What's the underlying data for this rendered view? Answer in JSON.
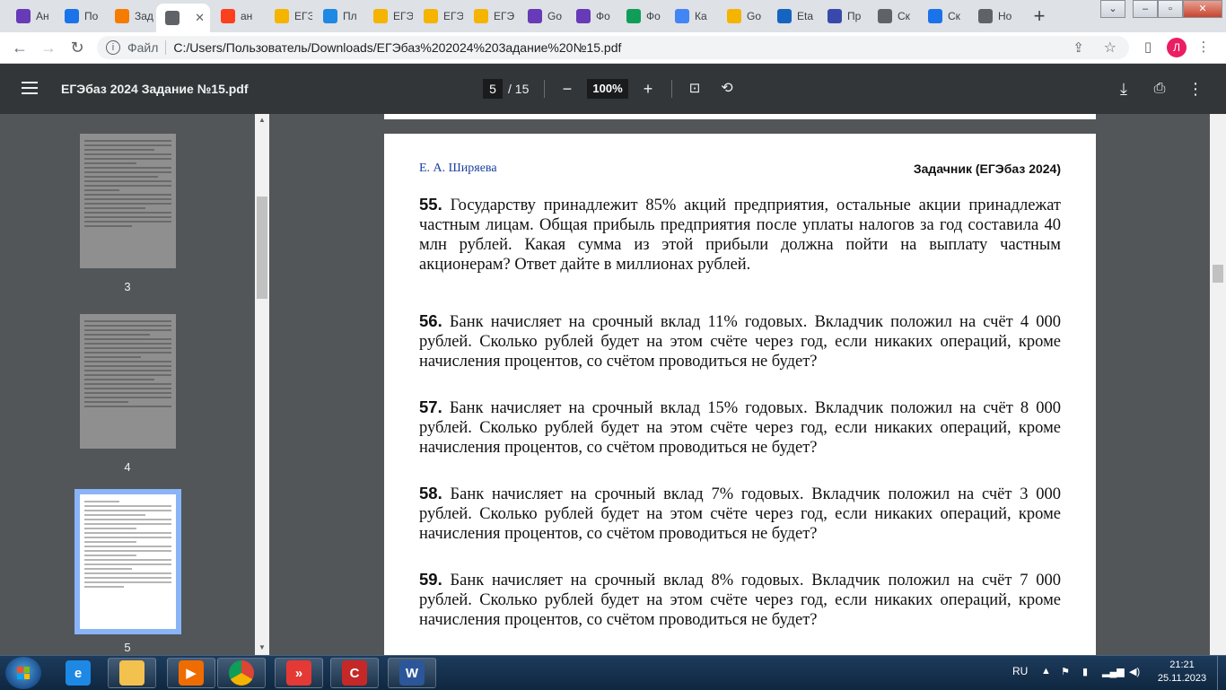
{
  "browser": {
    "tabs": [
      {
        "title": "Ан",
        "icon": "forms-icon",
        "color": "#673ab7"
      },
      {
        "title": "По",
        "icon": "mail-icon",
        "color": "#1a73e8"
      },
      {
        "title": "Зад",
        "icon": "fire-icon",
        "color": "#f57c00"
      },
      {
        "title": "",
        "icon": "globe-icon",
        "color": "#5f6368",
        "active": true
      },
      {
        "title": "ан",
        "icon": "yandex-icon",
        "color": "#fc3f1d"
      },
      {
        "title": "ЕГЭ",
        "icon": "sun-icon",
        "color": "#f4b400"
      },
      {
        "title": "Пл",
        "icon": "circle-icon",
        "color": "#1e88e5"
      },
      {
        "title": "ЕГЭ",
        "icon": "sun-icon",
        "color": "#f4b400"
      },
      {
        "title": "ЕГЭ",
        "icon": "sun-icon",
        "color": "#f4b400"
      },
      {
        "title": "ЕГЭ",
        "icon": "sun-icon",
        "color": "#f4b400"
      },
      {
        "title": "Go",
        "icon": "docs-icon",
        "color": "#673ab7"
      },
      {
        "title": "Фо",
        "icon": "forms-icon",
        "color": "#673ab7"
      },
      {
        "title": "Фо",
        "icon": "sheets-icon",
        "color": "#0f9d58"
      },
      {
        "title": "Ка",
        "icon": "google-icon",
        "color": "#4285f4"
      },
      {
        "title": "Go",
        "icon": "slides-icon",
        "color": "#f4b400"
      },
      {
        "title": "Eta",
        "icon": "emblem-icon",
        "color": "#1565c0"
      },
      {
        "title": "Пр",
        "icon": "swirl-icon",
        "color": "#3949ab"
      },
      {
        "title": "Ск",
        "icon": "globe-icon",
        "color": "#5f6368"
      },
      {
        "title": "Ск",
        "icon": "download-icon",
        "color": "#1a73e8"
      },
      {
        "title": "Но",
        "icon": "chrome-icon",
        "color": "#5f6368"
      }
    ],
    "address": {
      "scheme_label": "Файл",
      "url": "C:/Users/Пользователь/Downloads/ЕГЭбаз%202024%203адание%20№15.pdf"
    },
    "profile_initial": "Л",
    "profile_color": "#e91e63"
  },
  "pdf_viewer": {
    "title": "ЕГЭбаз 2024 Задание №15.pdf",
    "current_page": "5",
    "total_pages": "/ 15",
    "zoom": "100%",
    "thumbnails": [
      {
        "label": "3"
      },
      {
        "label": "4"
      },
      {
        "label": "5",
        "selected": true
      }
    ]
  },
  "page": {
    "header_left": "Е. А. Ширяева",
    "header_right": "Задачник (ЕГЭбаз 2024)",
    "problems": [
      {
        "num": "55.",
        "text": "Государству принадлежит 85% акций предприятия, остальные акции принадлежат частным лицам. Общая прибыль предприятия после уплаты налогов за год составила 40 млн рублей. Какая сумма из этой прибыли должна пойти на выплату частным акционерам? Ответ дайте в миллионах рублей."
      },
      {
        "num": "56.",
        "text": "Банк начисляет на срочный вклад 11% годовых. Вкладчик положил на счёт 4 000 рублей. Сколько рублей будет на этом счёте через год, если никаких операций, кроме начисления процентов, со счётом проводиться не будет?"
      },
      {
        "num": "57.",
        "text": "Банк начисляет на срочный вклад 15% годовых. Вкладчик положил на счёт 8 000 рублей. Сколько рублей будет на этом счёте через год, если никаких операций, кроме начисления процентов, со счётом проводиться не будет?"
      },
      {
        "num": "58.",
        "text": "Банк начисляет на срочный вклад 7% годовых. Вкладчик положил на счёт 3 000 рублей. Сколько рублей будет на этом счёте через год, если никаких операций, кроме начисления процентов, со счётом проводиться не будет?"
      },
      {
        "num": "59.",
        "text": "Банк начисляет на срочный вклад 8% годовых. Вкладчик положил на счёт 7 000 рублей. Сколько рублей будет на этом счёте через год, если никаких операций, кроме начисления процентов, со счётом проводиться не будет?"
      }
    ]
  },
  "taskbar": {
    "language": "RU",
    "time": "21:21",
    "date": "25.11.2023",
    "apps": [
      {
        "icon": "ie-icon",
        "label": "e",
        "color": "#1e88e5"
      },
      {
        "icon": "explorer-icon",
        "label": "",
        "color": "#f2c14e"
      },
      {
        "icon": "media-player-icon",
        "label": "▶",
        "color": "#ef6c00"
      },
      {
        "icon": "chrome-icon",
        "label": "",
        "color": "#db4437"
      },
      {
        "icon": "anydesk-icon",
        "label": "»",
        "color": "#e53935"
      },
      {
        "icon": "ccleaner-icon",
        "label": "C",
        "color": "#c62828"
      },
      {
        "icon": "word-icon",
        "label": "W",
        "color": "#2b579a"
      }
    ]
  }
}
